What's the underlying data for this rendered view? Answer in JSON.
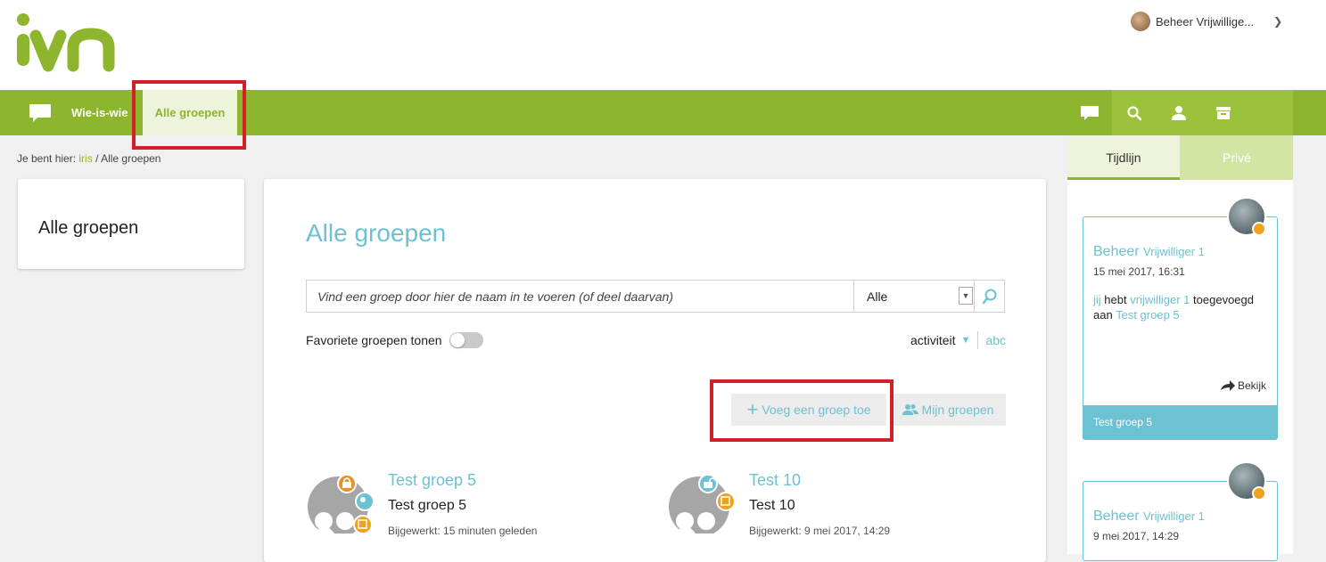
{
  "header": {
    "logo_text": "ivn",
    "user_name": "Beheer Vrijwillige...",
    "brand_color": "#8db52d",
    "accent_color": "#6cc1d2"
  },
  "nav": {
    "chat_icon": "chat-bubble-icon",
    "items": [
      {
        "label": "Wie-is-wie"
      },
      {
        "label": "Alle groepen"
      }
    ]
  },
  "breadcrumb": {
    "prefix": "Je bent hier:",
    "link": "iris",
    "separator": "/",
    "current": "Alle groepen"
  },
  "sidebar": {
    "title": "Alle groepen"
  },
  "main": {
    "title": "Alle groepen",
    "search_placeholder": "Vind een groep door hier de naam in te voeren (of deel daarvan)",
    "select_value": "Alle",
    "fav_label": "Favoriete groepen tonen",
    "sort_active": "activiteit",
    "sort_other": "abc",
    "add_button": "Voeg een groep toe",
    "mine_button": "Mijn groepen",
    "groups": [
      {
        "name": "Test groep 5",
        "subtitle": "Test groep 5",
        "updated": "Bijgewerkt: 15 minuten geleden"
      },
      {
        "name": "Test 10",
        "subtitle": "Test 10",
        "updated": "Bijgewerkt: 9 mei 2017, 14:29"
      }
    ]
  },
  "right_panel": {
    "tabs": [
      "Tijdlijn",
      "Privé"
    ],
    "timeline": [
      {
        "name_a": "Beheer",
        "name_b": "Vrijwilliger 1",
        "date": "15 mei 2017, 16:31",
        "text_jij": "jij",
        "text_hebt": "hebt",
        "text_user": "vrijwilliger 1",
        "text_mid": "toegevoegd aan",
        "text_group": "Test groep 5",
        "action": "Bekijk",
        "footer": "Test groep 5"
      },
      {
        "name_a": "Beheer",
        "name_b": "Vrijwilliger 1",
        "date": "9 mei 2017, 14:29"
      }
    ]
  }
}
